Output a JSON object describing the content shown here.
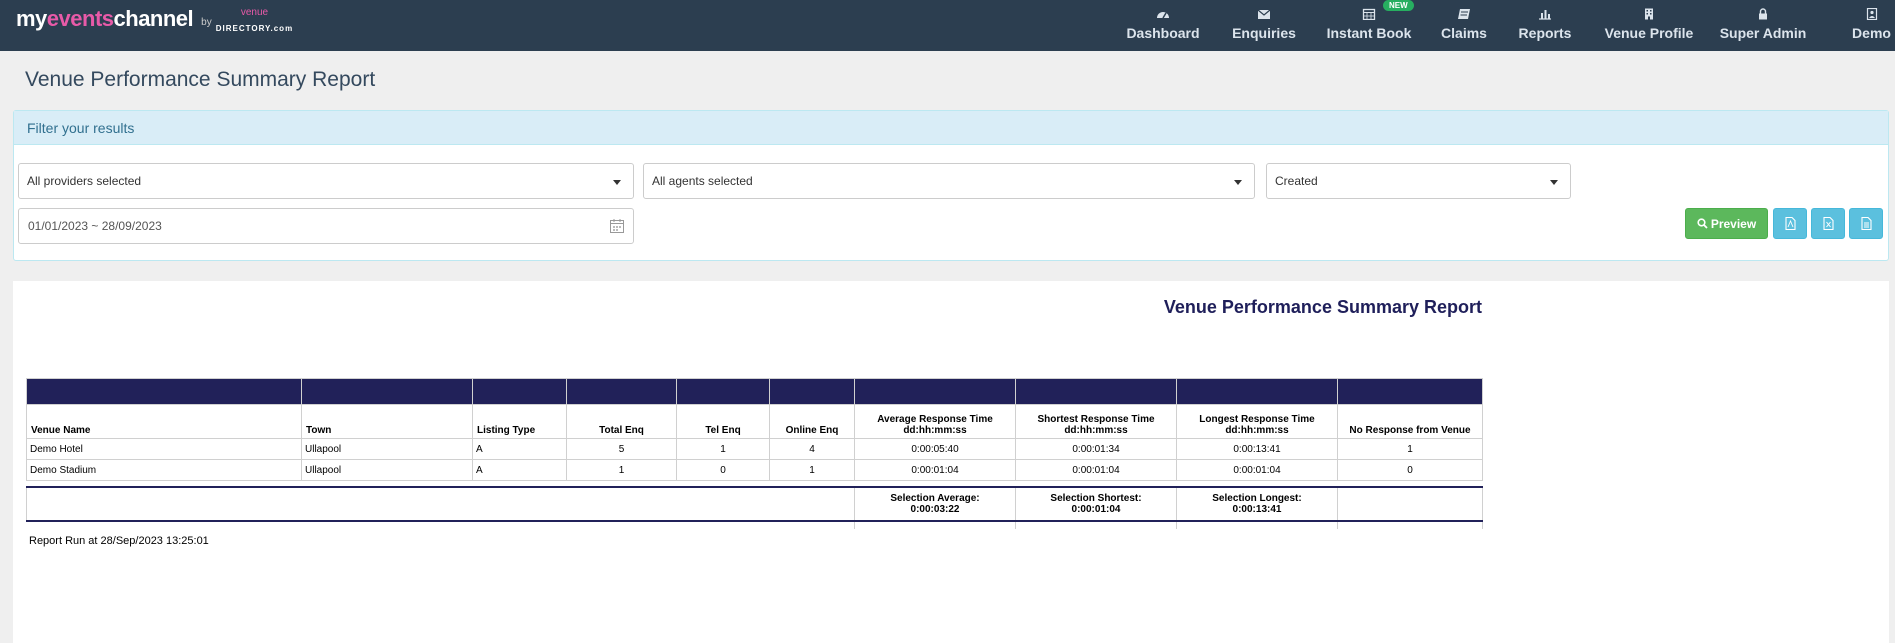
{
  "brand": {
    "name_prefix": "my",
    "name_highlight": "events",
    "name_suffix": "channel",
    "by": "by",
    "partner_top": "venue",
    "partner_bottom": "DIRECTORY.com"
  },
  "nav": [
    {
      "label": "Dashboard",
      "icon": "dashboard-icon"
    },
    {
      "label": "Enquiries",
      "icon": "envelope-icon"
    },
    {
      "label": "Instant Book",
      "icon": "calendar-icon",
      "badge": "NEW"
    },
    {
      "label": "Claims",
      "icon": "claims-icon"
    },
    {
      "label": "Reports",
      "icon": "bar-chart-icon"
    },
    {
      "label": "Venue Profile",
      "icon": "building-icon"
    },
    {
      "label": "Super Admin",
      "icon": "lock-icon"
    },
    {
      "label": "Demo",
      "icon": "user-icon"
    }
  ],
  "page_title": "Venue Performance Summary Report",
  "filter": {
    "heading": "Filter your results",
    "providers": "All providers selected",
    "agents": "All agents selected",
    "date_type": "Created",
    "date_range": "01/01/2023 ~ 28/09/2023",
    "preview_label": "Preview"
  },
  "report": {
    "title": "Venue Performance Summary Report",
    "columns": [
      {
        "line1": "Venue Name",
        "line2": ""
      },
      {
        "line1": "Town",
        "line2": ""
      },
      {
        "line1": "Listing Type",
        "line2": ""
      },
      {
        "line1": "Total Enq",
        "line2": ""
      },
      {
        "line1": "Tel Enq",
        "line2": ""
      },
      {
        "line1": "Online Enq",
        "line2": ""
      },
      {
        "line1": "Average Response Time",
        "line2": "dd:hh:mm:ss"
      },
      {
        "line1": "Shortest Response Time",
        "line2": "dd:hh:mm:ss"
      },
      {
        "line1": "Longest Response Time",
        "line2": "dd:hh:mm:ss"
      },
      {
        "line1": "No Response from Venue",
        "line2": ""
      }
    ],
    "rows": [
      [
        "Demo Hotel",
        "Ullapool",
        "A",
        "5",
        "1",
        "4",
        "0:00:05:40",
        "0:00:01:34",
        "0:00:13:41",
        "1"
      ],
      [
        "Demo Stadium",
        "Ullapool",
        "A",
        "1",
        "0",
        "1",
        "0:00:01:04",
        "0:00:01:04",
        "0:00:01:04",
        "0"
      ]
    ],
    "summary": {
      "avg_label": "Selection Average:",
      "avg_value": "0:00:03:22",
      "short_label": "Selection Shortest:",
      "short_value": "0:00:01:04",
      "long_label": "Selection Longest:",
      "long_value": "0:00:13:41"
    },
    "run_at": "Report Run at 28/Sep/2023 13:25:01"
  }
}
